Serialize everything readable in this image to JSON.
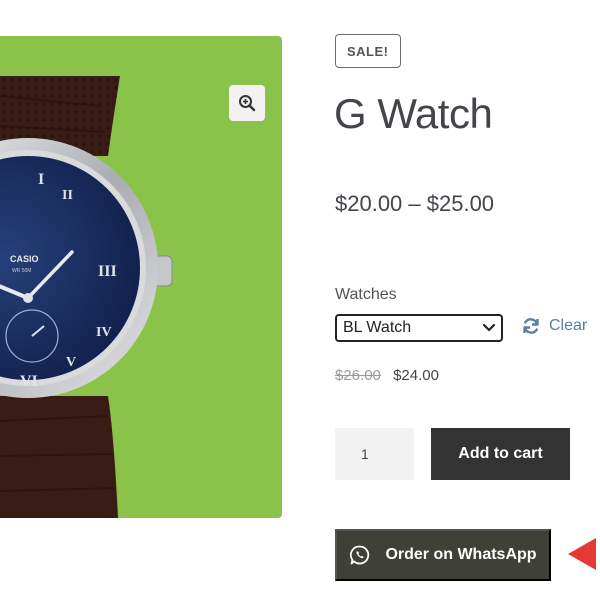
{
  "badge": {
    "sale": "SALE!"
  },
  "product": {
    "title": "G Watch",
    "price_range": "$20.00 – $25.00"
  },
  "gallery": {
    "zoom_icon": "zoom-in-icon",
    "background": "#8bc34a"
  },
  "variation": {
    "label": "Watches",
    "selected": "BL Watch",
    "clear_label": "Clear",
    "old_price": "$26.00",
    "new_price": "$24.00"
  },
  "cart": {
    "quantity": "1",
    "add_label": "Add to cart"
  },
  "whatsapp": {
    "label": "Order on WhatsApp",
    "icon": "whatsapp-icon"
  },
  "colors": {
    "accent": "#8bc34a",
    "button_dark": "#333333",
    "whatsapp_button": "#3f4138",
    "link_blue": "#5a7ea5",
    "arrow_red": "#e53935"
  }
}
